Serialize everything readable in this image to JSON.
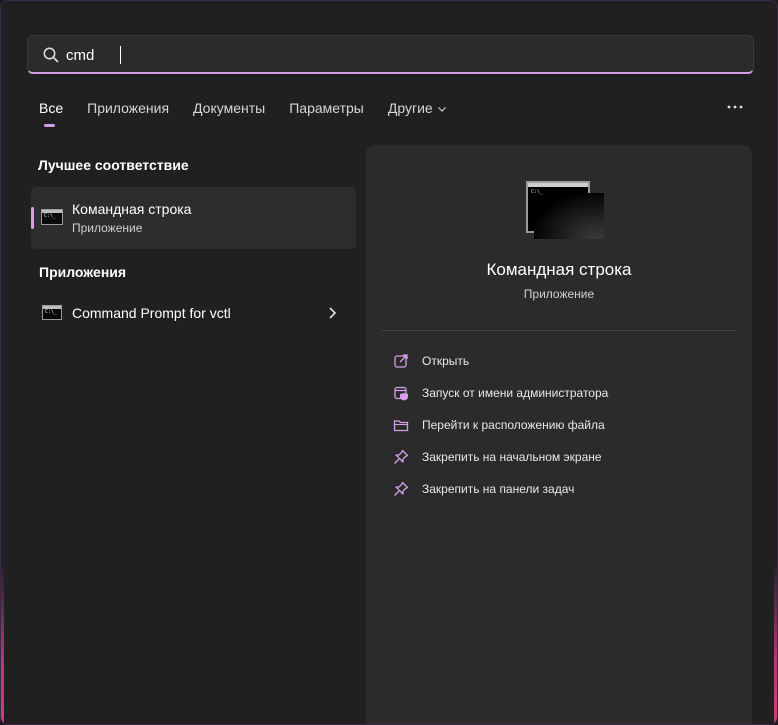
{
  "search": {
    "value": "cmd"
  },
  "tabs": [
    {
      "label": "Все",
      "active": true
    },
    {
      "label": "Приложения"
    },
    {
      "label": "Документы"
    },
    {
      "label": "Параметры"
    },
    {
      "label": "Другие"
    }
  ],
  "best_match": {
    "section_title": "Лучшее соответствие",
    "title": "Командная строка",
    "subtitle": "Приложение"
  },
  "apps": {
    "section_title": "Приложения",
    "items": [
      {
        "label": "Command Prompt for vctl"
      }
    ]
  },
  "detail": {
    "title": "Командная строка",
    "subtitle": "Приложение",
    "actions": [
      {
        "label": "Открыть",
        "icon": "open-external-icon"
      },
      {
        "label": "Запуск от имени администратора",
        "icon": "run-as-admin-icon"
      },
      {
        "label": "Перейти к расположению файла",
        "icon": "folder-icon"
      },
      {
        "label": "Закрепить на начальном экране",
        "icon": "pin-icon"
      },
      {
        "label": "Закрепить на панели задач",
        "icon": "pin-icon"
      }
    ]
  },
  "colors": {
    "accent": "#d59ee8",
    "background": "#202020",
    "panel": "#2b2b2b"
  }
}
